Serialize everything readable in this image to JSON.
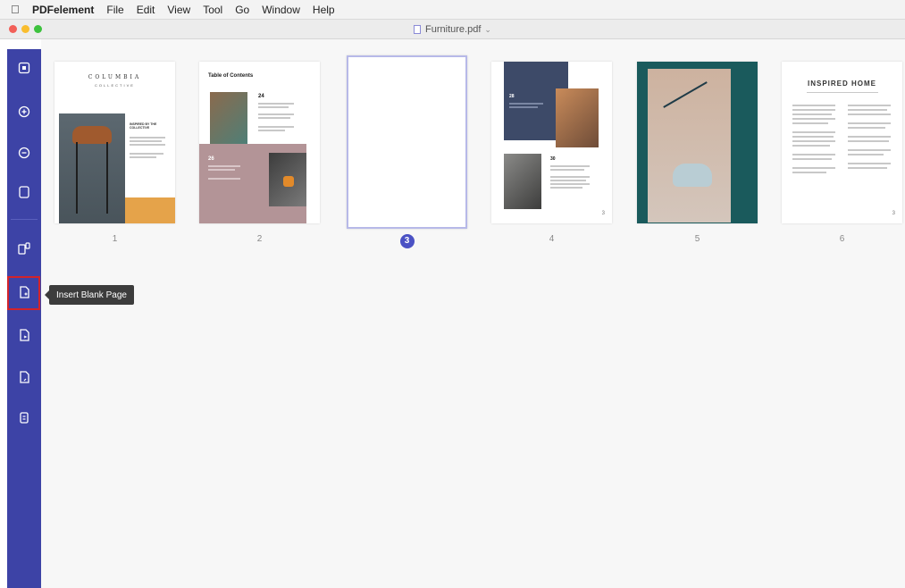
{
  "menubar": {
    "apple": "",
    "app_name": "PDFelement",
    "items": [
      "File",
      "Edit",
      "View",
      "Tool",
      "Go",
      "Window",
      "Help"
    ]
  },
  "window": {
    "title": "Furniture.pdf",
    "title_chevron": "⌄"
  },
  "sidebar": {
    "tooltip": "Insert Blank Page",
    "accent_color": "#3d43a6",
    "highlight_color": "#d2232a"
  },
  "pages": [
    {
      "number": "1",
      "title": "COLUMBIA",
      "subtitle": "COLLECTIVE",
      "caption": "INSPIRED BY THE COLLECTIVE"
    },
    {
      "number": "2",
      "title": "Table of Contents",
      "items": [
        "24",
        "26"
      ]
    },
    {
      "number": "3",
      "blank": true
    },
    {
      "number": "4",
      "items": [
        "28",
        "30"
      ],
      "page_mark": "3"
    },
    {
      "number": "5"
    },
    {
      "number": "6",
      "title": "INSPIRED HOME",
      "page_mark": "3"
    }
  ]
}
